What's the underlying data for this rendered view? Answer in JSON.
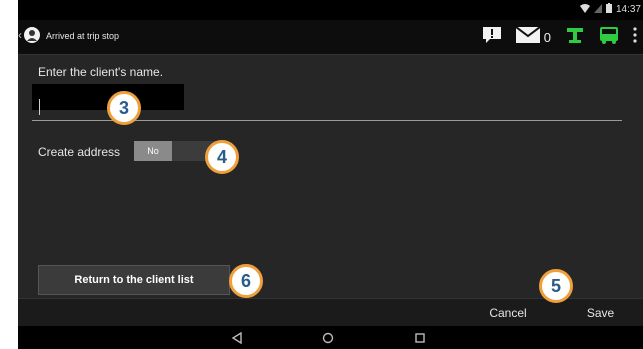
{
  "status_bar": {
    "time": "14:37",
    "icons": [
      "wifi-icon",
      "signal-icon",
      "battery-icon"
    ]
  },
  "app_bar": {
    "title": "Arrived at trip stop",
    "message_count": "0",
    "icons": [
      "back-icon",
      "trip-stop-icon",
      "alert-icon",
      "mail-icon",
      "route-icon",
      "bus-icon",
      "overflow-menu-icon"
    ],
    "colors": {
      "route": "#2ecc40",
      "bus": "#2ecc40"
    }
  },
  "form": {
    "prompt": "Enter the client's name.",
    "name_value": "",
    "create_address_label": "Create address",
    "create_address_toggle": "No",
    "return_button": "Return to the client list"
  },
  "footer": {
    "cancel": "Cancel",
    "save": "Save"
  },
  "nav": {
    "icons": [
      "nav-back-icon",
      "nav-home-icon",
      "nav-recents-icon"
    ]
  },
  "callouts": [
    "3",
    "4",
    "5",
    "6"
  ],
  "accent": "#f0a03a"
}
